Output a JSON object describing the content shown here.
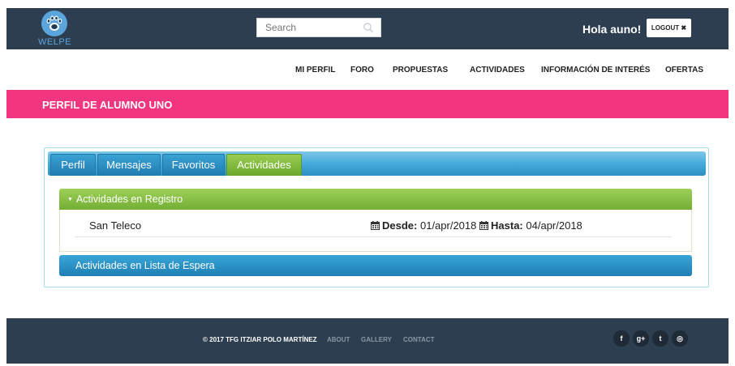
{
  "header": {
    "logo_text": "WELPE",
    "search": {
      "placeholder": "Search",
      "value": ""
    },
    "greeting": "Hola auno!",
    "logout_label": "LOGOUT ✖"
  },
  "nav": {
    "items": [
      {
        "label": "MI PERFIL"
      },
      {
        "label": "FORO"
      },
      {
        "label": "PROPUESTAS"
      },
      {
        "label": "ACTIVIDADES"
      },
      {
        "label": "INFORMACIÓN DE INTERÉS"
      },
      {
        "label": "OFERTAS"
      }
    ]
  },
  "banner": {
    "title": "PERFIL DE ALUMNO UNO"
  },
  "tabs": [
    {
      "label": "Perfil",
      "active": false
    },
    {
      "label": "Mensajes",
      "active": false
    },
    {
      "label": "Favoritos",
      "active": false
    },
    {
      "label": "Actividades",
      "active": true
    }
  ],
  "activities": {
    "registered_header": "Actividades en Registro",
    "registered": [
      {
        "name": "San Teleco",
        "from_label": "Desde:",
        "from": "01/apr/2018",
        "to_label": "Hasta:",
        "to": "04/apr/2018"
      }
    ],
    "waitlist_header": "Actividades en Lista de Espera"
  },
  "footer": {
    "copyright": "© 2017 TFG ITZIAR POLO MARTÍNEZ",
    "links": [
      {
        "label": "ABOUT"
      },
      {
        "label": "GALLERY"
      },
      {
        "label": "CONTACT"
      }
    ],
    "social": [
      {
        "icon": "facebook-icon",
        "glyph": "f"
      },
      {
        "icon": "google-plus-icon",
        "glyph": "g+"
      },
      {
        "icon": "twitter-icon",
        "glyph": "t"
      },
      {
        "icon": "dribbble-icon",
        "glyph": "◎"
      }
    ]
  },
  "colors": {
    "topbar": "#2d3e50",
    "banner": "#f2357f",
    "tab_blue": "#1f7bb0",
    "tab_active_green": "#6aa82b",
    "accordion_green": "#72ae32",
    "accordion_blue": "#1e7fb4"
  }
}
